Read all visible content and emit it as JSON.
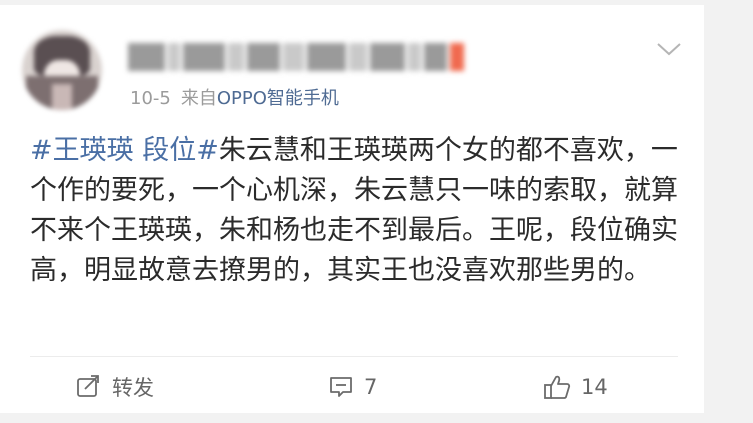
{
  "post": {
    "meta": {
      "date": "10-5",
      "source_prefix": "来自",
      "source_name": "OPPO智能手机"
    },
    "content": {
      "topic": "#王瑛瑛 段位#",
      "text": "朱云慧和王瑛瑛两个女的都不喜欢，一个作的要死，一个心机深，朱云慧只一味的索取，就算不来个王瑛瑛，朱和杨也走不到最后。王呢，段位确实高，明显故意去撩男的，其实王也没喜欢那些男的。"
    },
    "actions": {
      "repost_label": "转发",
      "comment_count": "7",
      "like_count": "14"
    },
    "icons": {
      "menu": "chevron-down-icon",
      "repost": "repost-icon",
      "comment": "comment-icon",
      "like": "thumbs-up-icon"
    },
    "colors": {
      "topic": "#4a6fa5",
      "source": "#4f6b93",
      "meta": "#9b9b9b",
      "text": "#2b2b2b"
    }
  }
}
